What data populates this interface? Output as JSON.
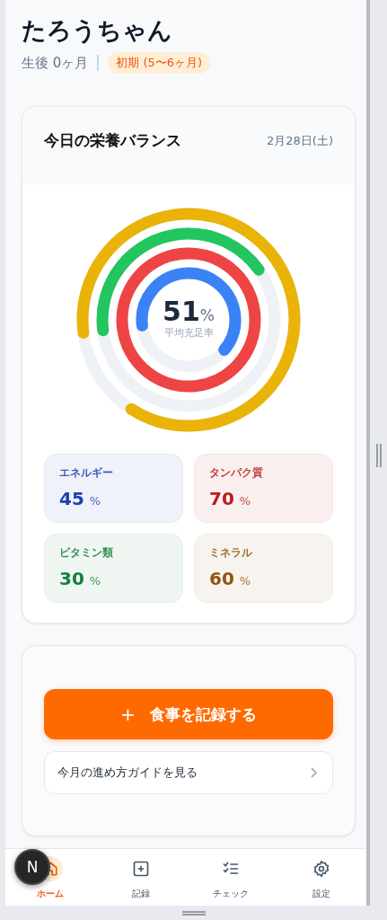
{
  "header": {
    "name": "たろうちゃん",
    "age": "生後 0ヶ月",
    "stage": "初期 (5〜6ヶ月)"
  },
  "balance_card": {
    "title": "今日の栄養バランス",
    "date": "2月28日(土)",
    "rings": [
      {
        "level": 0.63
      },
      {
        "level": 1
      },
      {
        "level": 0.42
      },
      {
        "level": 0.86
      }
    ],
    "average": {
      "value": "51",
      "unit": "%",
      "label": "平均充足率"
    },
    "nutrients": [
      {
        "name": "エネルギー",
        "value": "45",
        "unit": "%",
        "color": "#1e40af"
      },
      {
        "name": "タンパク質",
        "value": "70",
        "unit": "%",
        "color": "#b91c1c"
      },
      {
        "name": "ビタミン類",
        "value": "30",
        "unit": "%",
        "color": "#15803d"
      },
      {
        "name": "ミネラル",
        "value": "60",
        "unit": "%",
        "color": "#92560e"
      }
    ]
  },
  "actions": {
    "record_button": {
      "icon": "+",
      "label": "食事を記録する"
    },
    "guide_link": "今月の進め方ガイドを見る"
  },
  "nav": [
    {
      "kind": "home",
      "label": "ホーム",
      "selected": true
    },
    {
      "kind": "add",
      "label": "記録",
      "selected": false
    },
    {
      "kind": "checklist",
      "label": "チェック",
      "selected": false
    },
    {
      "kind": "settings",
      "label": "設定",
      "selected": false
    }
  ],
  "dev_badge": "N"
}
